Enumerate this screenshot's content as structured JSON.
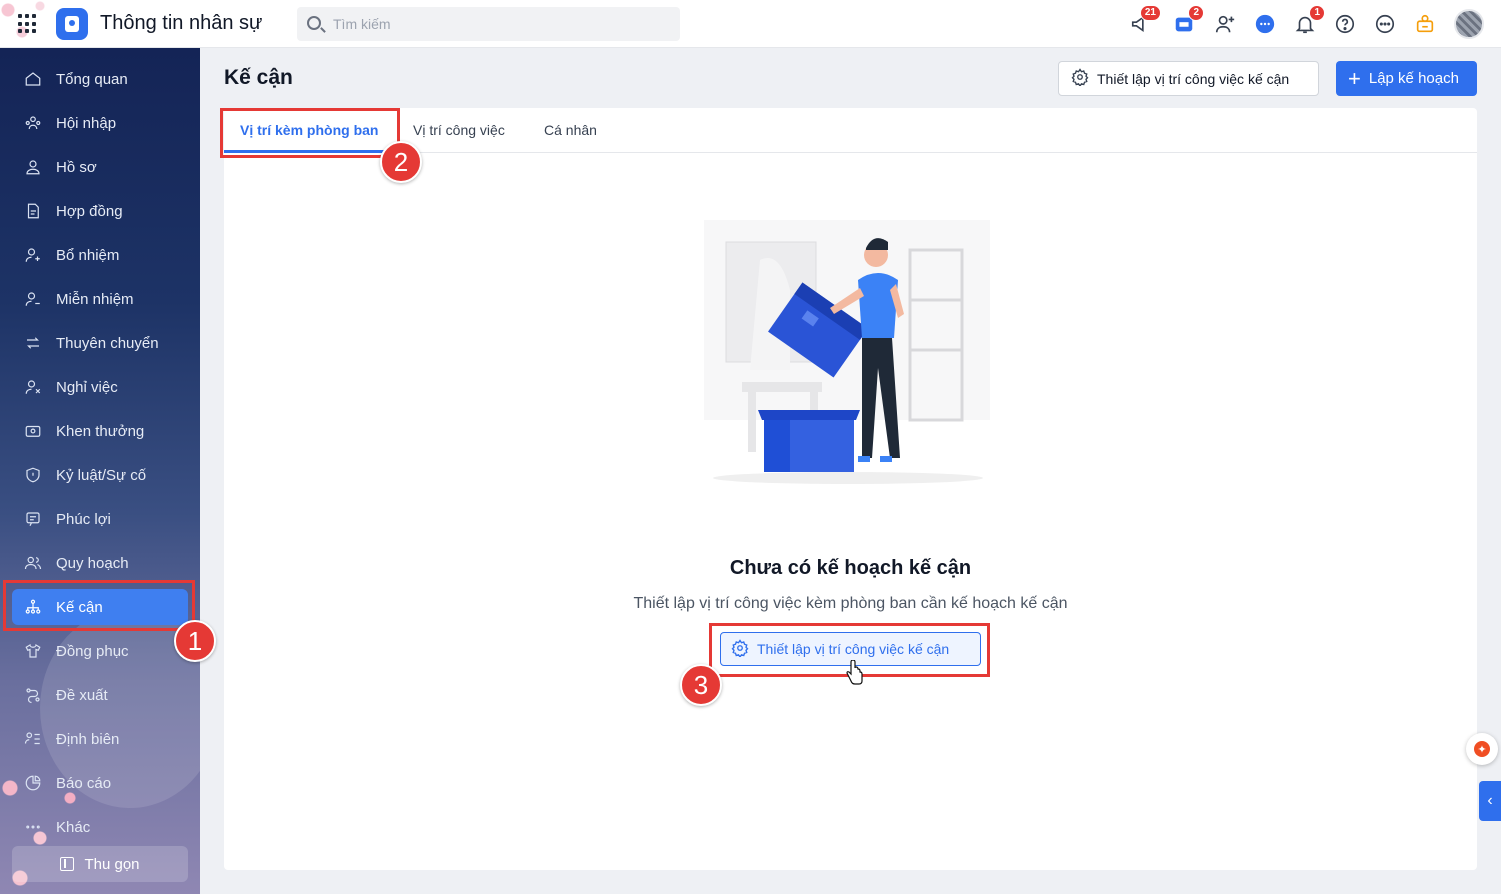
{
  "header": {
    "app_title": "Thông tin nhân sự",
    "search_placeholder": "Tìm kiếm",
    "badges": {
      "announcements": "21",
      "store": "2",
      "notifications": "1"
    }
  },
  "sidebar": {
    "items": [
      {
        "label": "Tổng quan",
        "icon": "home-icon"
      },
      {
        "label": "Hội nhập",
        "icon": "people-icon"
      },
      {
        "label": "Hồ sơ",
        "icon": "user-icon"
      },
      {
        "label": "Hợp đồng",
        "icon": "document-icon"
      },
      {
        "label": "Bổ nhiệm",
        "icon": "user-plus-icon"
      },
      {
        "label": "Miễn nhiệm",
        "icon": "user-minus-icon"
      },
      {
        "label": "Thuyên chuyển",
        "icon": "transfer-icon"
      },
      {
        "label": "Nghỉ việc",
        "icon": "user-x-icon"
      },
      {
        "label": "Khen thưởng",
        "icon": "reward-icon"
      },
      {
        "label": "Kỷ luật/Sự cố",
        "icon": "shield-icon"
      },
      {
        "label": "Phúc lợi",
        "icon": "benefit-icon"
      },
      {
        "label": "Quy hoạch",
        "icon": "users-icon"
      },
      {
        "label": "Kế cận",
        "icon": "org-chart-icon"
      },
      {
        "label": "Đồng phục",
        "icon": "shirt-icon"
      },
      {
        "label": "Đề xuất",
        "icon": "proposal-icon"
      },
      {
        "label": "Định biên",
        "icon": "headcount-icon"
      },
      {
        "label": "Báo cáo",
        "icon": "chart-icon"
      },
      {
        "label": "Khác",
        "icon": "more-icon"
      }
    ],
    "active_item": "Kế cận",
    "collapse_label": "Thu gọn"
  },
  "page": {
    "title": "Kế cận",
    "setup_button": "Thiết lập vị trí công việc kế cận",
    "create_button": "Lập kế hoạch"
  },
  "tabs": [
    {
      "label": "Vị trí kèm phòng ban",
      "active": true
    },
    {
      "label": "Vị trí công việc",
      "active": false
    },
    {
      "label": "Cá nhân",
      "active": false
    }
  ],
  "empty_state": {
    "title": "Chưa có kế hoạch kế cận",
    "description": "Thiết lập vị trí công việc kèm phòng ban cần kế hoạch kế cận",
    "button": "Thiết lập vị trí công việc kế cận"
  },
  "annotations": [
    "1",
    "2",
    "3"
  ],
  "colors": {
    "accent": "#2f6fed",
    "highlight": "#e53935",
    "sidebar": "#142456"
  }
}
